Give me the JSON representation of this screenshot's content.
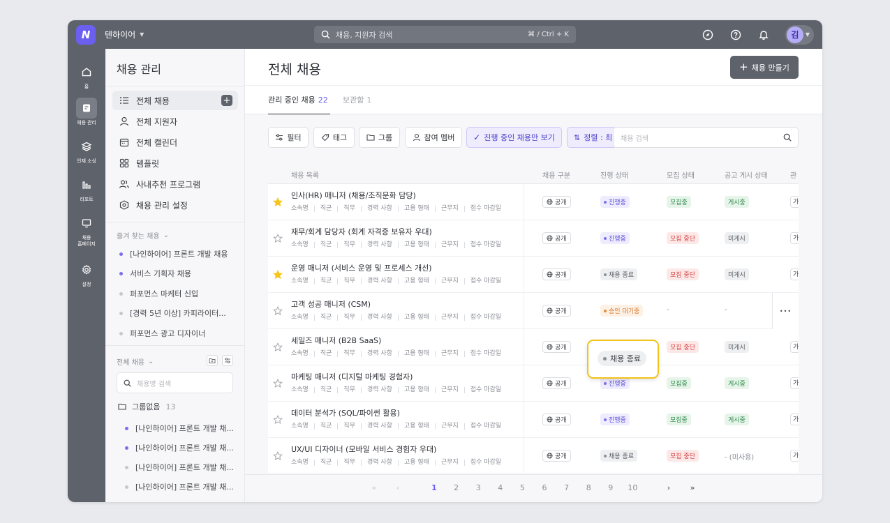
{
  "topbar": {
    "logo": "N",
    "org_name": "텐하이어",
    "search_placeholder": "채용, 지원자 검색",
    "search_shortcut": "⌘ / Ctrl + K",
    "avatar_initial": "김"
  },
  "rail": {
    "items": [
      {
        "label": "홈",
        "icon": "home-icon"
      },
      {
        "label": "채용 관리",
        "icon": "recruit-icon",
        "active": true
      },
      {
        "label": "인재 소싱",
        "icon": "layers-icon"
      },
      {
        "label": "리포트",
        "icon": "chart-icon"
      },
      {
        "label": "채용\n홈페이지",
        "icon": "monitor-icon"
      },
      {
        "label": "설정",
        "icon": "gear-icon"
      }
    ]
  },
  "panel": {
    "title": "채용 관리",
    "nav": [
      {
        "label": "전체 채용",
        "icon": "list-icon",
        "active": true
      },
      {
        "label": "전체 지원자",
        "icon": "user-icon"
      },
      {
        "label": "전체 캘린더",
        "icon": "calendar-icon"
      },
      {
        "label": "템플릿",
        "icon": "grid-icon"
      },
      {
        "label": "사내추천 프로그램",
        "icon": "users-icon"
      },
      {
        "label": "채용 관리 설정",
        "icon": "hexagon-icon"
      }
    ],
    "favorites_label": "즐겨 찾는 채용",
    "favorites": [
      {
        "label": "[나인하이어] 프론트 개발 채용",
        "color": "#7b6ff0"
      },
      {
        "label": "서비스 기획자 채용",
        "color": "#7b6ff0"
      },
      {
        "label": "퍼포먼스 마케터 신입",
        "color": "#c5c7cc"
      },
      {
        "label": "[경력 5년 이상] 카피라이터...",
        "color": "#c5c7cc"
      },
      {
        "label": "퍼포먼스 광고 디자이너",
        "color": "#c5c7cc"
      }
    ],
    "all_label": "전체 채용",
    "search_placeholder": "채용명 검색",
    "group_label": "그룹없음",
    "group_count": "13",
    "group_items": [
      {
        "label": "[나인하이어] 프론트 개발 채...",
        "color": "#7b6ff0"
      },
      {
        "label": "[나인하이어] 프론트 개발 채...",
        "color": "#7b6ff0"
      },
      {
        "label": "[나인하이어] 프론트 개발 채...",
        "color": "#c5c7cc"
      },
      {
        "label": "[나인하이어] 프론트 개발 채...",
        "color": "#c5c7cc"
      }
    ]
  },
  "main": {
    "title": "전체 채용",
    "create_button": "채용 만들기",
    "tabs": [
      {
        "label": "관리 중인 채용",
        "count": "22"
      },
      {
        "label": "보관함",
        "count": "1"
      }
    ],
    "filters": {
      "filter": "필터",
      "tag": "태그",
      "group": "그룹",
      "members": "참여 멤버",
      "in_progress_only": "진행 중인 채용만 보기",
      "sort": "정렬 : 최",
      "search_placeholder": "채용 검색"
    },
    "columns": [
      "채용 목록",
      "채용 구분",
      "진행 상태",
      "모집 상태",
      "공고 게시 상태",
      "관"
    ],
    "meta_fields": [
      "소속명",
      "직군",
      "직무",
      "경력 사항",
      "고용 형태",
      "근무지",
      "접수 마감일"
    ],
    "rows": [
      {
        "title": "인사(HR) 매니저 (채용/조직문화 담당)",
        "starred": true,
        "type": "공개",
        "status": "진행중",
        "status_kind": "progress",
        "recruit": "모집중",
        "recruit_kind": "recruiting",
        "post": "게시중",
        "post_kind": "posted",
        "edge": "가"
      },
      {
        "title": "재무/회계 담당자 (회계 자격증 보유자 우대)",
        "starred": false,
        "type": "공개",
        "status": "진행중",
        "status_kind": "progress",
        "recruit": "모집 중단",
        "recruit_kind": "stopped",
        "post": "미게시",
        "post_kind": "unposted",
        "edge": "가"
      },
      {
        "title": "운영 매니저 (서비스 운영 및 프로세스 개선)",
        "starred": true,
        "type": "공개",
        "status": "채용 종료",
        "status_kind": "ended",
        "recruit": "모집 중단",
        "recruit_kind": "stopped",
        "post": "미게시",
        "post_kind": "unposted",
        "edge": "가"
      },
      {
        "title": "고객 성공 매니저 (CSM)",
        "starred": false,
        "type": "공개",
        "status": "승인 대기중",
        "status_kind": "pending",
        "recruit": "-",
        "recruit_kind": "none",
        "post": "-",
        "post_kind": "none",
        "edge": "",
        "more": true
      },
      {
        "title": "세일즈 매니저 (B2B SaaS)",
        "starred": false,
        "type": "공개",
        "status": "채용 종료",
        "status_kind": "ended",
        "recruit": "모집 중단",
        "recruit_kind": "stopped",
        "post": "미게시",
        "post_kind": "unposted",
        "edge": "가"
      },
      {
        "title": "마케팅 매니저 (디지털 마케팅 경험자)",
        "starred": false,
        "type": "공개",
        "status": "진행중",
        "status_kind": "progress",
        "recruit": "모집중",
        "recruit_kind": "recruiting",
        "post": "게시중",
        "post_kind": "posted",
        "edge": "가"
      },
      {
        "title": "데이터 분석가 (SQL/파이썬 활용)",
        "starred": false,
        "type": "공개",
        "status": "진행중",
        "status_kind": "progress",
        "recruit": "모집중",
        "recruit_kind": "recruiting",
        "post": "게시중",
        "post_kind": "posted",
        "edge": "가"
      },
      {
        "title": "UX/UI 디자이너 (모바일 서비스 경험자 우대)",
        "starred": false,
        "type": "공개",
        "status": "채용 종료",
        "status_kind": "ended",
        "recruit": "모집 중단",
        "recruit_kind": "stopped",
        "post": "-  (미사용)",
        "post_kind": "none",
        "edge": "가"
      }
    ],
    "highlight_status": "채용 종료",
    "pagination": {
      "first": "«",
      "prev": "‹",
      "pages": [
        "1",
        "2",
        "3",
        "4",
        "5",
        "6",
        "7",
        "8",
        "9",
        "10"
      ],
      "current": "1",
      "next": "›",
      "last": "»"
    }
  },
  "colors": {
    "accent": "#6b5ff0",
    "topbar": "#5e626b",
    "highlight": "#f2c318",
    "star": "#f5c518"
  }
}
